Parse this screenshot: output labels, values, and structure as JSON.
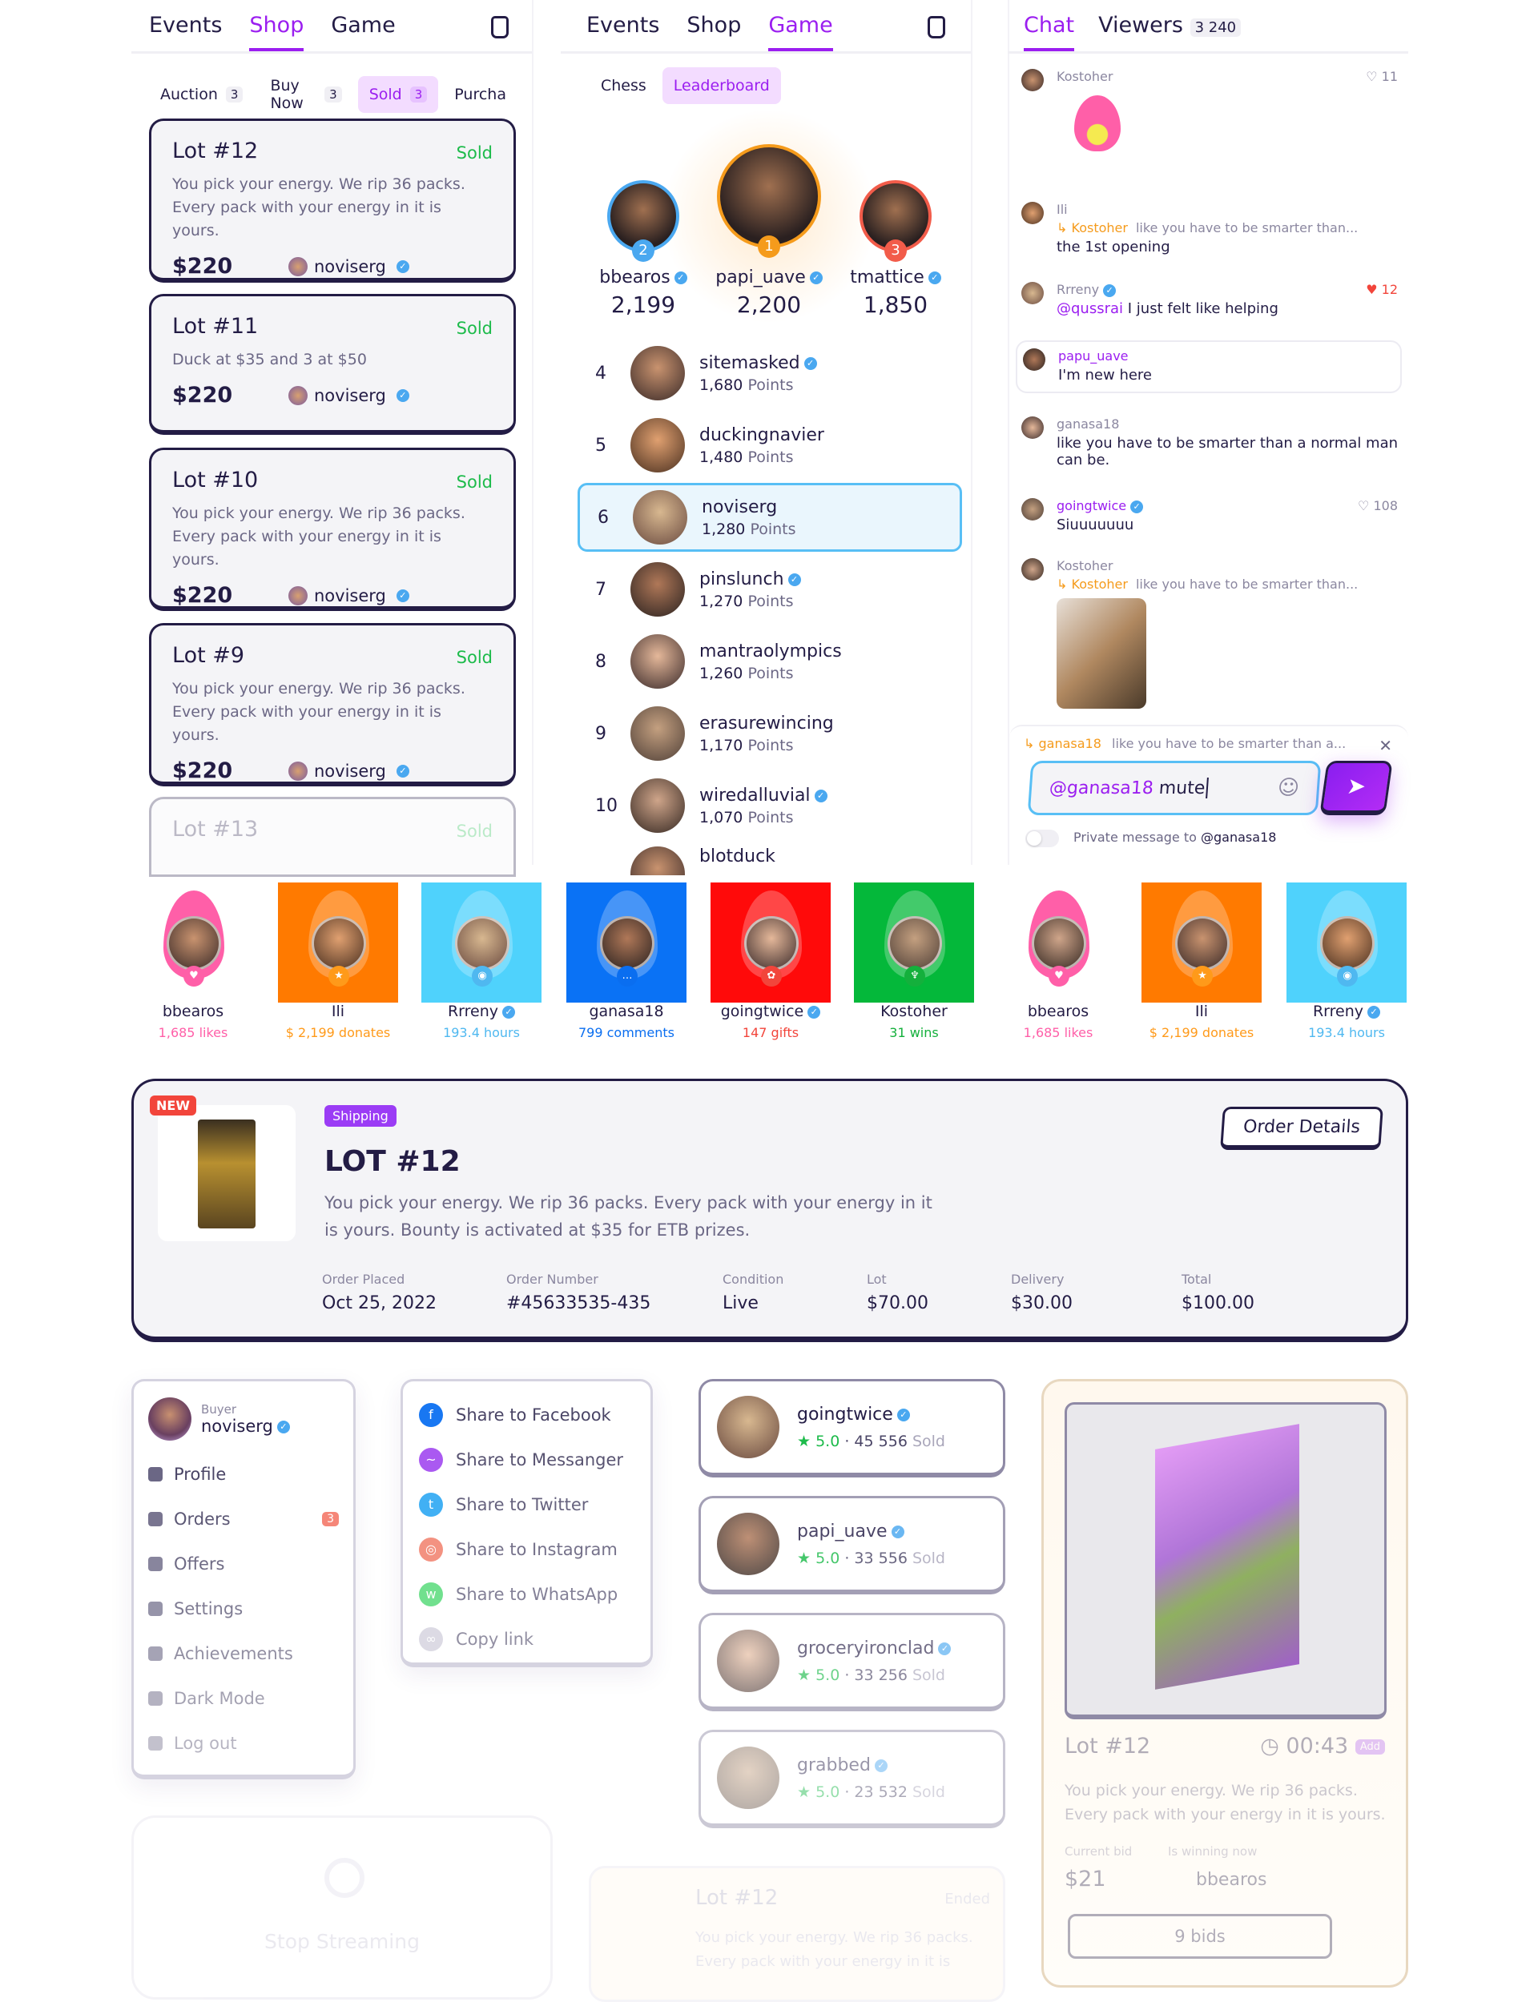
{
  "shop_panel": {
    "tabs": [
      "Events",
      "Shop",
      "Game"
    ],
    "active_tab": "Shop",
    "bag_icon": "shopping-bag-icon",
    "subtabs": [
      {
        "label": "Auction",
        "count": "3"
      },
      {
        "label": "Buy Now",
        "count": "3"
      },
      {
        "label": "Sold",
        "count": "3",
        "active": true
      },
      {
        "label": "Purcha",
        "count": ""
      }
    ],
    "lots": [
      {
        "title": "Lot #12",
        "status": "Sold",
        "desc": "You pick your energy. We rip 36 packs. Every pack with your energy in it is yours.",
        "price": "$220",
        "user": "noviserg"
      },
      {
        "title": "Lot #11",
        "status": "Sold",
        "desc": "Duck at $35 and 3 at $50",
        "price": "$220",
        "user": "noviserg"
      },
      {
        "title": "Lot #10",
        "status": "Sold",
        "desc": "You pick your energy. We rip 36 packs. Every pack with your energy in it is yours.",
        "price": "$220",
        "user": "noviserg"
      },
      {
        "title": "Lot #9",
        "status": "Sold",
        "desc": "You pick your energy. We rip 36 packs. Every pack with your energy in it is yours.",
        "price": "$220",
        "user": "noviserg"
      },
      {
        "title": "Lot #13",
        "status": "Sold",
        "desc": "",
        "price": "",
        "user": ""
      }
    ]
  },
  "game_panel": {
    "tabs": [
      "Events",
      "Shop",
      "Game"
    ],
    "active_tab": "Game",
    "subtabs": [
      "Chess",
      "Leaderboard"
    ],
    "active_subtab": "Leaderboard",
    "podium": [
      {
        "rank": "2",
        "name": "bbearos",
        "score": "2,199",
        "color": "#4aa8f0"
      },
      {
        "rank": "1",
        "name": "papi_uave",
        "score": "2,200",
        "color": "#f59b1c"
      },
      {
        "rank": "3",
        "name": "tmattice",
        "score": "1,850",
        "color": "#f25c4a"
      }
    ],
    "rows": [
      {
        "rank": "4",
        "name": "sitemasked",
        "points": "1,680",
        "verified": true
      },
      {
        "rank": "5",
        "name": "duckingnavier",
        "points": "1,480",
        "verified": false
      },
      {
        "rank": "6",
        "name": "noviserg",
        "points": "1,280",
        "verified": false,
        "highlight": true
      },
      {
        "rank": "7",
        "name": "pinslunch",
        "points": "1,270",
        "verified": true
      },
      {
        "rank": "8",
        "name": "mantraolympics",
        "points": "1,260",
        "verified": false
      },
      {
        "rank": "9",
        "name": "erasurewincing",
        "points": "1,170",
        "verified": false
      },
      {
        "rank": "10",
        "name": "wiredalluvial",
        "points": "1,070",
        "verified": true
      },
      {
        "rank": "",
        "name": "blotduck",
        "points": "",
        "verified": false
      }
    ],
    "points_label": "Points"
  },
  "chat_panel": {
    "tabs": [
      "Chat",
      "Viewers"
    ],
    "viewers_count": "3 240",
    "messages": [
      {
        "user": "Kostoher",
        "likes": "11",
        "sticker": "fire-sticker"
      },
      {
        "user": "Ili",
        "reply_to": "Kostoher",
        "reply_text": "like you have to be smarter than...",
        "text": "the 1st opening"
      },
      {
        "user": "Rrreny",
        "verified": true,
        "likes": "12",
        "liked": true,
        "mention": "@qussrai",
        "text": "I just felt like helping"
      },
      {
        "user": "papu_uave",
        "text": "I'm new here",
        "highlight": true
      },
      {
        "user": "ganasa18",
        "text": "like you have to be smarter than a normal man can be."
      },
      {
        "user": "goingtwice",
        "verified": true,
        "likes": "108",
        "text": "Siuuuuuuu"
      },
      {
        "user": "Kostoher",
        "reply_to": "Kostoher",
        "reply_text": "like you have to be smarter than...",
        "image": "cat-photo"
      }
    ],
    "reply_bar": {
      "user": "ganasa18",
      "text": "like you have to be smarter than a..."
    },
    "input": {
      "mention": "@ganasa18",
      "value": "mute"
    },
    "private_label": "Private message to",
    "private_user": "@ganasa18"
  },
  "streamers": [
    {
      "name": "bbearos",
      "stat": "1,685 likes",
      "color": "#ff5fa8",
      "bg": "transparent",
      "verified": false
    },
    {
      "name": "Ili",
      "stat": "$ 2,199 donates",
      "color": "#ff9a1a",
      "bg": "#ff7a00",
      "verified": false
    },
    {
      "name": "Rrreny",
      "stat": "193.4 hours",
      "color": "#4fb8f0",
      "bg": "#4fd2fc",
      "verified": true
    },
    {
      "name": "ganasa18",
      "stat": "799 comments",
      "color": "#0a6ef0",
      "bg": "#0a72f5",
      "verified": false
    },
    {
      "name": "goingtwice",
      "stat": "147 gifts",
      "color": "#f2453b",
      "bg": "#ff0a0a",
      "verified": true
    },
    {
      "name": "Kostoher",
      "stat": "31 wins",
      "color": "#14b03c",
      "bg": "#04b83a",
      "verified": false
    },
    {
      "name": "bbearos",
      "stat": "1,685 likes",
      "color": "#ff5fa8",
      "bg": "transparent",
      "verified": false
    },
    {
      "name": "Ili",
      "stat": "$ 2,199 donates",
      "color": "#ff9a1a",
      "bg": "#ff7a00",
      "verified": false
    },
    {
      "name": "Rrreny",
      "stat": "193.4 hours",
      "color": "#4fb8f0",
      "bg": "#4fd2fc",
      "verified": true
    }
  ],
  "order": {
    "badge": "NEW",
    "status": "Shipping",
    "title": "LOT #12",
    "desc": "You pick your energy. We rip 36 packs. Every pack with your energy in it is yours. Bounty is activated at $35 for ETB prizes.",
    "button": "Order Details",
    "meta": [
      {
        "label": "Order Placed",
        "value": "Oct 25, 2022"
      },
      {
        "label": "Order Number",
        "value": "#45633535-435"
      },
      {
        "label": "Condition",
        "value": "Live"
      },
      {
        "label": "Lot",
        "value": "$70.00"
      },
      {
        "label": "Delivery",
        "value": "$30.00"
      },
      {
        "label": "Total",
        "value": "$100.00"
      }
    ]
  },
  "user_menu": {
    "role": "Buyer",
    "name": "noviserg",
    "items": [
      {
        "label": "Profile",
        "icon": "user-icon"
      },
      {
        "label": "Orders",
        "icon": "bookmark-icon",
        "badge": "3"
      },
      {
        "label": "Offers",
        "icon": "tag-icon"
      },
      {
        "label": "Settings",
        "icon": "gear-icon"
      },
      {
        "label": "Achievements",
        "icon": "star-icon"
      },
      {
        "label": "Dark Mode",
        "icon": "moon-icon"
      },
      {
        "label": "Log out",
        "icon": "logout-icon"
      }
    ]
  },
  "share_menu": [
    {
      "label": "Share to Facebook",
      "color": "#1877f2",
      "glyph": "f"
    },
    {
      "label": "Share to Messanger",
      "color": "#a34cf0",
      "glyph": "~"
    },
    {
      "label": "Share to Twitter",
      "color": "#1da1f2",
      "glyph": "t"
    },
    {
      "label": "Share to Instagram",
      "color": "#f0705a",
      "glyph": "◎"
    },
    {
      "label": "Share to WhatsApp",
      "color": "#2fd25a",
      "glyph": "w"
    },
    {
      "label": "Copy link",
      "color": "#c5c3d3",
      "glyph": "∞"
    }
  ],
  "sellers": [
    {
      "name": "goingtwice",
      "rating": "5.0",
      "sold": "45 556",
      "sold_label": "Sold"
    },
    {
      "name": "papi_uave",
      "rating": "5.0",
      "sold": "33 556",
      "sold_label": "Sold"
    },
    {
      "name": "groceryironclad",
      "rating": "5.0",
      "sold": "33 256",
      "sold_label": "Sold"
    },
    {
      "name": "grabbed",
      "rating": "5.0",
      "sold": "23 532",
      "sold_label": "Sold"
    }
  ],
  "auction_card": {
    "title": "Lot #12",
    "timer": "00:43",
    "add": "Add",
    "desc": "You pick your energy. We rip 36 packs. Every pack with your energy in it is yours.",
    "bid_label": "Current bid",
    "bid": "$21",
    "winner_label": "Is winning now",
    "winner": "bbearos",
    "bids": "9 bids"
  },
  "stream_card": {
    "label": "Stop Streaming"
  },
  "ended_card": {
    "title": "Lot #12",
    "status": "Ended",
    "desc": "You pick your energy. We rip 36 packs. Every pack with your energy in it is"
  }
}
